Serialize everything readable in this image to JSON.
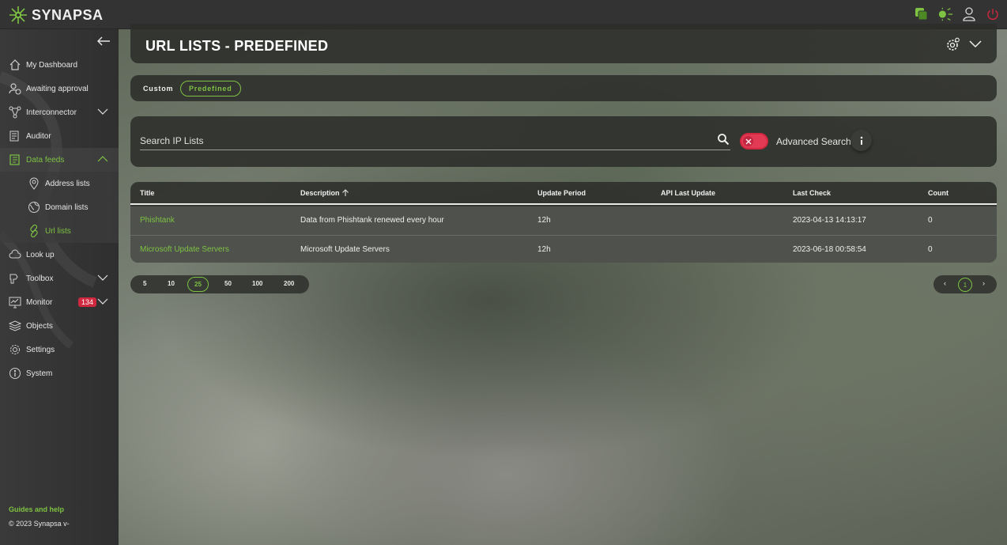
{
  "app": {
    "brand": "SYNAPSA",
    "accent_color": "#7dc242",
    "alert_color": "#d0283f"
  },
  "topbar": {
    "icons": [
      "windows-icon",
      "theme-toggle-icon",
      "user-icon",
      "power-icon"
    ]
  },
  "sidebar": {
    "items": [
      {
        "label": "My Dashboard",
        "icon": "home-icon"
      },
      {
        "label": "Awaiting approval",
        "icon": "user-clock-icon"
      },
      {
        "label": "Interconnector",
        "icon": "network-icon"
      },
      {
        "label": "Auditor",
        "icon": "auditor-icon"
      },
      {
        "label": "Data feeds",
        "icon": "feed-icon"
      },
      {
        "label": "Look up",
        "icon": "cloud-icon"
      },
      {
        "label": "Toolbox",
        "icon": "toolbox-icon"
      },
      {
        "label": "Monitor",
        "icon": "monitor-icon",
        "badge": "134"
      },
      {
        "label": "Objects",
        "icon": "layers-icon"
      },
      {
        "label": "Settings",
        "icon": "settings-icon"
      },
      {
        "label": "System",
        "icon": "system-icon"
      }
    ],
    "subitems": [
      {
        "label": "Address lists",
        "icon": "pin-icon"
      },
      {
        "label": "Domain lists",
        "icon": "globe-icon"
      },
      {
        "label": "Url lists",
        "icon": "link-icon"
      }
    ],
    "footer": {
      "guides": "Guides and help",
      "copyright": "© 2023 Synapsa v-"
    }
  },
  "page": {
    "title": "URL LISTS - PREDEFINED"
  },
  "tabs": {
    "custom": "Custom",
    "predefined": "Predefined"
  },
  "search": {
    "placeholder": "Search IP Lists",
    "value": "",
    "advanced_label": "Advanced Search"
  },
  "table": {
    "columns": [
      "Title",
      "Description",
      "Update Period",
      "API Last Update",
      "Last Check",
      "Count"
    ],
    "rows": [
      {
        "title": "Phishtank",
        "description": "Data from Phishtank renewed every hour",
        "update_period": "12h",
        "api_last_update": "",
        "last_check": "2023-04-13 14:13:17",
        "count": "0"
      },
      {
        "title": "Microsoft Update Servers",
        "description": "Microsoft Update Servers",
        "update_period": "12h",
        "api_last_update": "",
        "last_check": "2023-06-18 00:58:54",
        "count": "0"
      }
    ]
  },
  "pagination": {
    "page_sizes": [
      "5",
      "10",
      "25",
      "50",
      "100",
      "200"
    ],
    "selected_size": "25",
    "prev": "‹",
    "current_page": "1",
    "next": "›"
  }
}
